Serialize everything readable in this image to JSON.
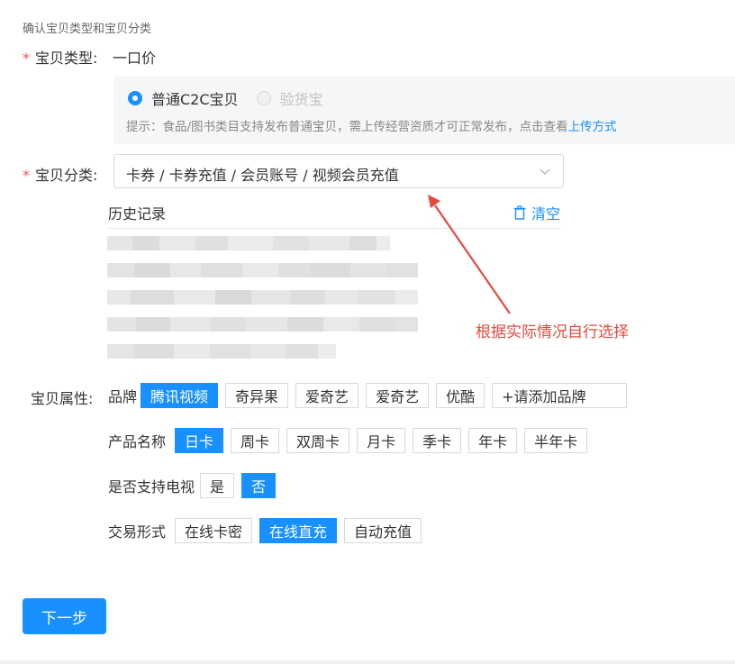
{
  "section_title": "确认宝贝类型和宝贝分类",
  "type_field": {
    "label": "宝贝类型:",
    "value": "一口价",
    "options": [
      {
        "label": "普通C2C宝贝",
        "selected": true,
        "disabled": false
      },
      {
        "label": "验货宝",
        "selected": false,
        "disabled": true
      }
    ],
    "hint_prefix": "提示：食品/图书类目支持发布普通宝贝，需上传经营资质才可正常发布，点击查看",
    "hint_link": "上传方式"
  },
  "category_field": {
    "label": "宝贝分类:",
    "value": "卡券 / 卡券充值 / 会员账号 / 视频会员充值"
  },
  "history": {
    "title": "历史记录",
    "clear_label": "清空"
  },
  "annotation": "根据实际情况自行选择",
  "attributes": {
    "label": "宝贝属性:",
    "brand": {
      "label": "品牌",
      "options": [
        "腾讯视频",
        "奇异果",
        "爱奇艺",
        "爱奇艺",
        "优酷",
        "+请添加品牌"
      ],
      "selected": 0
    },
    "product_name": {
      "label": "产品名称",
      "options": [
        "日卡",
        "周卡",
        "双周卡",
        "月卡",
        "季卡",
        "年卡",
        "半年卡"
      ],
      "selected": 0
    },
    "tv_support": {
      "label": "是否支持电视",
      "options": [
        "是",
        "否"
      ],
      "selected": 1
    },
    "trade_form": {
      "label": "交易形式",
      "options": [
        "在线卡密",
        "在线直充",
        "自动充值"
      ],
      "selected": 1
    }
  },
  "next_button": "下一步",
  "colors": {
    "accent": "#1890ff",
    "required_star": "#ff4d4f",
    "annotation": "#e64a3f"
  }
}
